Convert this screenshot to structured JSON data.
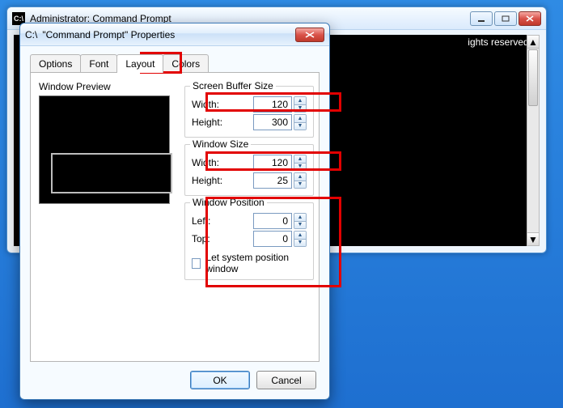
{
  "cmd": {
    "title": "Administrator: Command Prompt",
    "body_text": "ights reserved."
  },
  "dialog": {
    "title": "\"Command Prompt\" Properties",
    "tabs": {
      "options": "Options",
      "font": "Font",
      "layout": "Layout",
      "colors": "Colors"
    },
    "preview_label": "Window Preview",
    "groups": {
      "screen_buffer": {
        "legend": "Screen Buffer Size",
        "width_label": "Width:",
        "width_value": "120",
        "height_label": "Height:",
        "height_value": "300"
      },
      "window_size": {
        "legend": "Window Size",
        "width_label": "Width:",
        "width_value": "120",
        "height_label": "Height:",
        "height_value": "25"
      },
      "window_pos": {
        "legend": "Window Position",
        "left_label": "Left:",
        "left_value": "0",
        "top_label": "Top:",
        "top_value": "0",
        "checkbox_label": "Let system position window"
      }
    },
    "buttons": {
      "ok": "OK",
      "cancel": "Cancel"
    }
  }
}
